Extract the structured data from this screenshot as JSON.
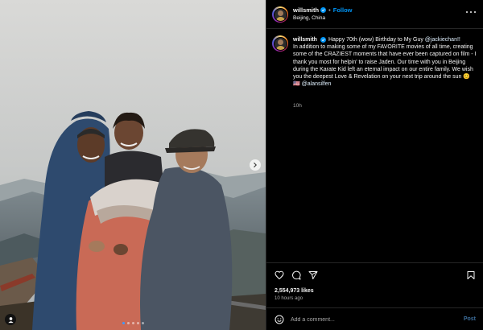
{
  "post": {
    "username": "willsmith",
    "follow_label": "Follow",
    "separator": "•",
    "location": "Beijing, China",
    "caption": {
      "username": "willsmith",
      "text_before_mention": "Happy 70th (wow) Birthday to My Guy ",
      "mention": "@jackiechan!!",
      "body": "In addition to making some of my FAVORITE movies of all time, creating some of the CRAZIEST moments that have ever been captured on film - I thank you most for helpin' to raise Jaden. Our time with you in Beijing during the Karate Kid left an eternal impact on our entire family. We wish you the deepest Love & Revelation on your next trip around the sun ",
      "emoji": "😊",
      "flag_emoji": "🇺🇸",
      "credit": "@alansilfen"
    },
    "time_ago": "10h",
    "likes": "2,554,973 likes",
    "posted_ago": "10 hours ago"
  },
  "comment": {
    "placeholder": "Add a comment...",
    "post_label": "Post"
  },
  "carousel": {
    "slide_count": 5,
    "active_index": 0
  },
  "colors": {
    "background": "#000000",
    "accent": "#0095f6",
    "verified": "#0095f6",
    "muted": "#a8a8a8",
    "divider": "#262626"
  },
  "icons": {
    "verified": "verified-badge-icon",
    "more": "more-options-icon",
    "like": "heart-icon",
    "comment": "comment-icon",
    "share": "share-icon",
    "save": "bookmark-icon",
    "emoji": "emoji-icon",
    "next": "chevron-right-icon",
    "profile": "user-icon"
  }
}
